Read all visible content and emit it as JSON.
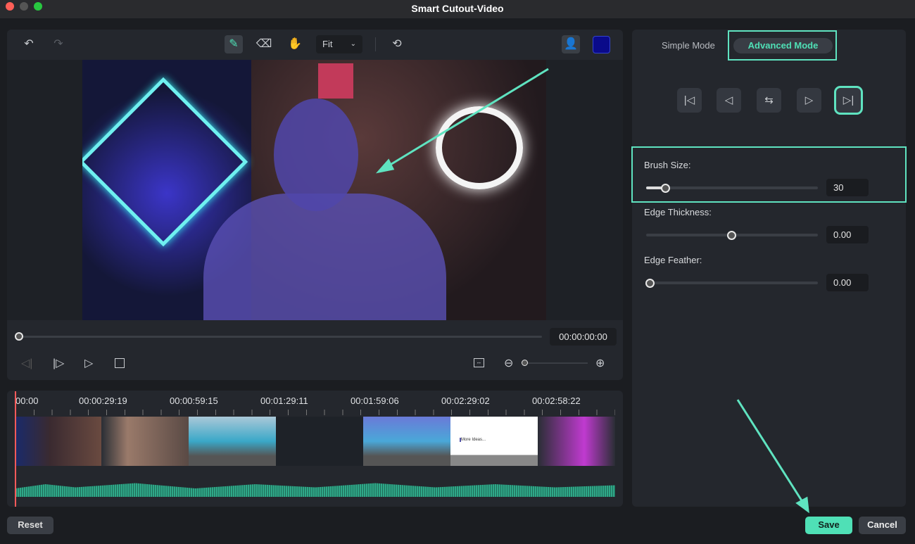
{
  "window": {
    "title": "Smart Cutout-Video"
  },
  "toolbar": {
    "zoom_select": "Fit",
    "icons": [
      "undo-icon",
      "redo-icon",
      "smart-brush-icon",
      "eraser-icon",
      "hand-icon",
      "refresh-icon",
      "person-icon"
    ],
    "color_swatch": "#0a0a8a"
  },
  "player": {
    "timecode": "00:00:00:00",
    "progress": 0
  },
  "timeline": {
    "ruler": [
      "00:00",
      "00:00:29:19",
      "00:00:59:15",
      "00:01:29:11",
      "00:01:59:06",
      "00:02:29:02",
      "00:02:58:22"
    ],
    "thumb_text": "More Ideas..."
  },
  "right_panel": {
    "modes": {
      "simple": "Simple Mode",
      "advanced": "Advanced Mode",
      "active": "advanced"
    },
    "brush_size": {
      "label": "Brush Size:",
      "value": "30",
      "fraction": 0.11
    },
    "edge_thickness": {
      "label": "Edge Thickness:",
      "value": "0.00",
      "fraction": 0.5
    },
    "edge_feather": {
      "label": "Edge Feather:",
      "value": "0.00",
      "fraction": 0
    }
  },
  "footer": {
    "reset": "Reset",
    "save": "Save",
    "cancel": "Cancel"
  },
  "colors": {
    "accent": "#4fe0b6",
    "highlight": "#5fe3c0",
    "save_bg": "#4fe0b6"
  }
}
